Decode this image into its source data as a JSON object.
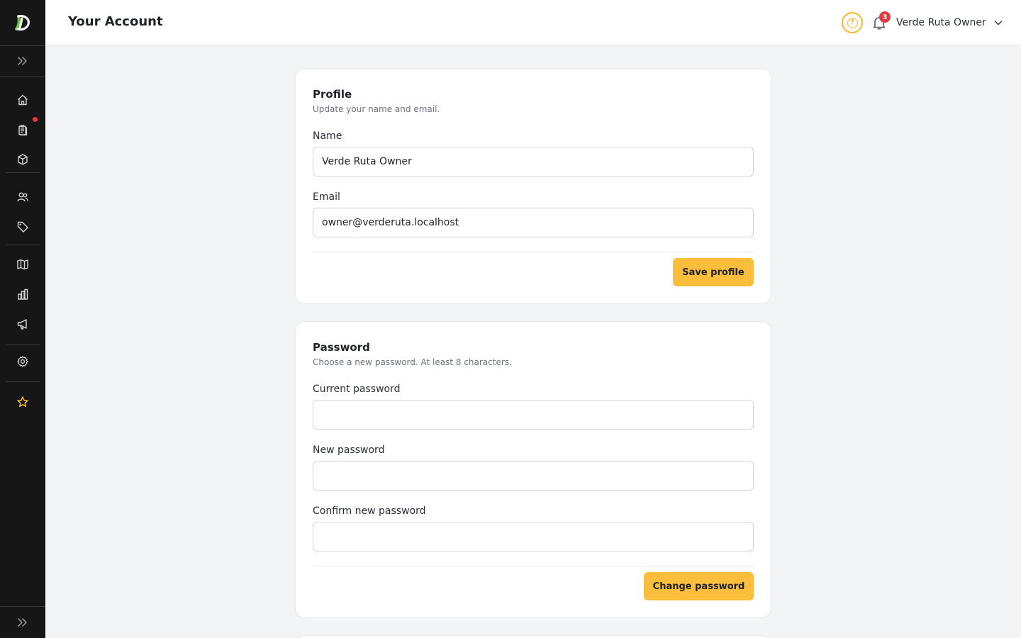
{
  "app": {
    "logo_letter": "D",
    "accent_color": "#fbbd3c",
    "sidebar_bg": "#161616",
    "logo_color": "#6bbf4a",
    "alert_color": "#e5383b"
  },
  "sidebar": {
    "items": [
      {
        "name": "expand-sidebar",
        "icon": "double-chevron-right-icon"
      },
      {
        "name": "home",
        "icon": "home-icon"
      },
      {
        "name": "orders",
        "icon": "clipboard-icon",
        "has_notification_dot": true
      },
      {
        "name": "products",
        "icon": "box-icon"
      },
      {
        "name": "customers",
        "icon": "users-icon"
      },
      {
        "name": "tags",
        "icon": "tag-icon"
      },
      {
        "name": "catalog",
        "icon": "map-icon"
      },
      {
        "name": "reports",
        "icon": "bar-chart-icon"
      },
      {
        "name": "marketing",
        "icon": "megaphone-icon"
      },
      {
        "name": "settings",
        "icon": "gear-icon"
      },
      {
        "name": "favorites",
        "icon": "star-icon"
      },
      {
        "name": "collapse-sidebar",
        "icon": "double-chevron-right-icon"
      }
    ]
  },
  "header": {
    "title": "Your Account",
    "help_icon": "question-circle-icon",
    "notifications": {
      "icon": "bell-icon",
      "count": "3"
    },
    "user": {
      "name": "Verde Ruta Owner",
      "icon": "chevron-down-icon"
    }
  },
  "profile": {
    "title": "Profile",
    "subtitle": "Update your name and email.",
    "name_label": "Name",
    "name_value": "Verde Ruta Owner",
    "email_label": "Email",
    "email_value": "owner@verderuta.localhost",
    "save_label": "Save profile"
  },
  "password": {
    "title": "Password",
    "subtitle": "Choose a new password. At least 8 characters.",
    "current_label": "Current password",
    "current_value": "",
    "new_label": "New password",
    "new_value": "",
    "confirm_label": "Confirm new password",
    "confirm_value": "",
    "submit_label": "Change password"
  }
}
